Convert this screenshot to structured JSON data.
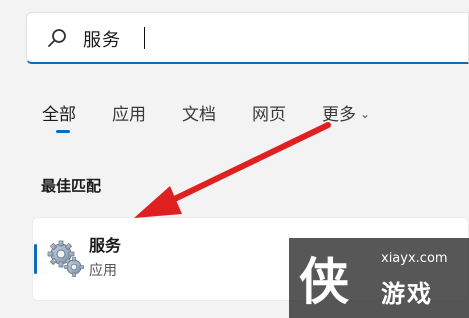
{
  "search": {
    "query": "服务"
  },
  "tabs": [
    {
      "label": "全部",
      "active": true
    },
    {
      "label": "应用",
      "active": false
    },
    {
      "label": "文档",
      "active": false
    },
    {
      "label": "网页",
      "active": false
    },
    {
      "label": "更多",
      "active": false
    }
  ],
  "best_match": {
    "section_title": "最佳匹配",
    "name": "服务",
    "type": "应用",
    "icon": "services-gear-icon"
  },
  "watermark": {
    "logo": "侠",
    "url": "xiayx.com",
    "name": "游戏"
  },
  "colors": {
    "accent": "#0f6cbd",
    "arrow": "#e02020",
    "background": "#f3f3f3"
  }
}
